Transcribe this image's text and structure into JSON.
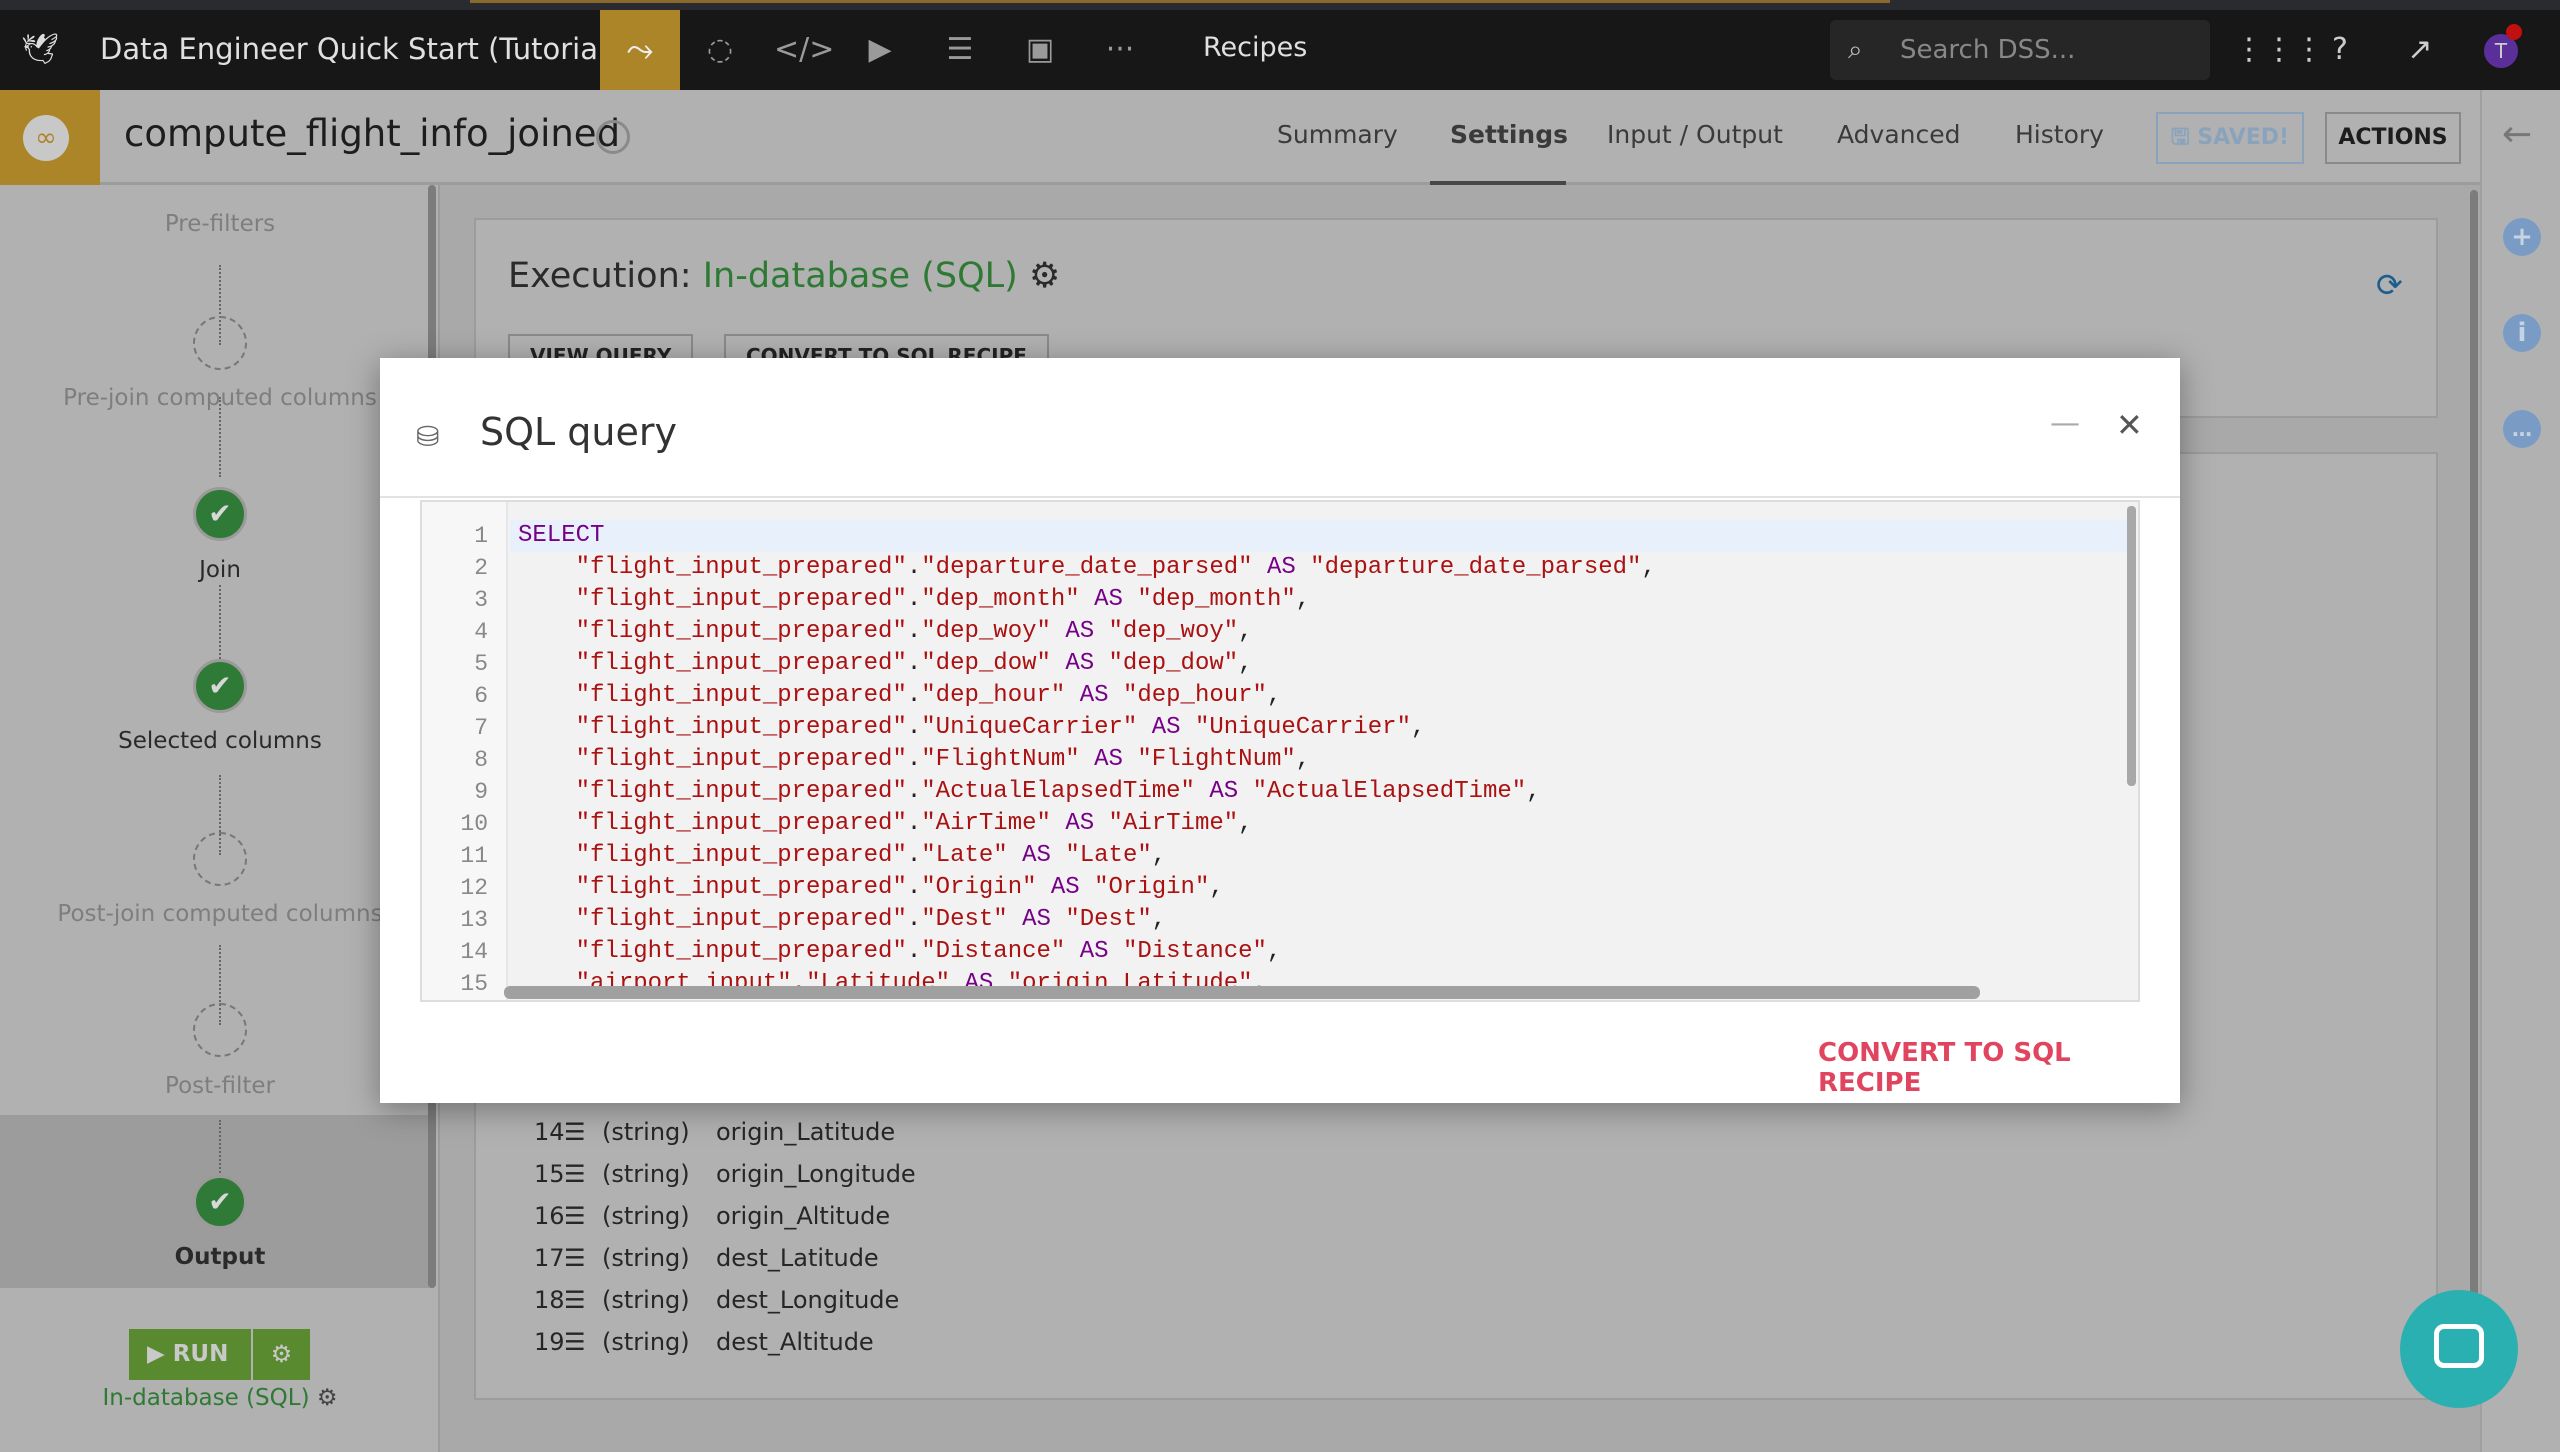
{
  "topbar": {
    "project_title": "Data Engineer Quick Start (Tutorial)",
    "section": "Recipes",
    "search_placeholder": "Search DSS...",
    "avatar_letter": "T",
    "icons": [
      "bird-logo-icon",
      "flow-icon",
      "jobs-icon",
      "code-icon",
      "run-icon",
      "datasets-icon",
      "dashboard-icon",
      "more-icon",
      "apps-grid-icon",
      "help-icon",
      "trend-icon"
    ]
  },
  "header": {
    "recipe_name": "compute_flight_info_joined",
    "tabs": [
      {
        "label": "Summary"
      },
      {
        "label": "Settings",
        "active": true
      },
      {
        "label": "Input / Output"
      },
      {
        "label": "Advanced"
      },
      {
        "label": "History"
      }
    ],
    "saved_label": "SAVED!",
    "actions_label": "ACTIONS"
  },
  "sidebar": {
    "steps": [
      {
        "label": "Pre-filters",
        "done": false
      },
      {
        "label": "Pre-join computed columns",
        "done": false
      },
      {
        "label": "Join",
        "done": true
      },
      {
        "label": "Selected columns",
        "done": true
      },
      {
        "label": "Post-join computed columns",
        "done": false
      },
      {
        "label": "Post-filter",
        "done": false
      },
      {
        "label": "Output",
        "done": true,
        "active": true
      }
    ],
    "run_label": "RUN",
    "engine_label": "In-database (SQL)"
  },
  "main": {
    "execution_label": "Execution:",
    "execution_engine": "In-database (SQL)",
    "view_query_label": "VIEW QUERY",
    "convert_label": "CONVERT TO SQL RECIPE",
    "columns": [
      {
        "index": "14",
        "type": "(string)",
        "name": "origin_Latitude"
      },
      {
        "index": "15",
        "type": "(string)",
        "name": "origin_Longitude"
      },
      {
        "index": "16",
        "type": "(string)",
        "name": "origin_Altitude"
      },
      {
        "index": "17",
        "type": "(string)",
        "name": "dest_Latitude"
      },
      {
        "index": "18",
        "type": "(string)",
        "name": "dest_Longitude"
      },
      {
        "index": "19",
        "type": "(string)",
        "name": "dest_Altitude"
      }
    ]
  },
  "modal": {
    "title": "SQL query",
    "convert_label": "CONVERT TO SQL RECIPE",
    "code_lines": [
      "SELECT",
      "    \"flight_input_prepared\".\"departure_date_parsed\" AS \"departure_date_parsed\",",
      "    \"flight_input_prepared\".\"dep_month\" AS \"dep_month\",",
      "    \"flight_input_prepared\".\"dep_woy\" AS \"dep_woy\",",
      "    \"flight_input_prepared\".\"dep_dow\" AS \"dep_dow\",",
      "    \"flight_input_prepared\".\"dep_hour\" AS \"dep_hour\",",
      "    \"flight_input_prepared\".\"UniqueCarrier\" AS \"UniqueCarrier\",",
      "    \"flight_input_prepared\".\"FlightNum\" AS \"FlightNum\",",
      "    \"flight_input_prepared\".\"ActualElapsedTime\" AS \"ActualElapsedTime\",",
      "    \"flight_input_prepared\".\"AirTime\" AS \"AirTime\",",
      "    \"flight_input_prepared\".\"Late\" AS \"Late\",",
      "    \"flight_input_prepared\".\"Origin\" AS \"Origin\",",
      "    \"flight_input_prepared\".\"Dest\" AS \"Dest\",",
      "    \"flight_input_prepared\".\"Distance\" AS \"Distance\",",
      "    \"airport_input\".\"Latitude\" AS \"origin_Latitude\","
    ]
  },
  "colors": {
    "accent_gold": "#ad8529",
    "success_green": "#2f7a36",
    "danger_link": "#e0445e",
    "intercom": "#2ab0b0"
  }
}
